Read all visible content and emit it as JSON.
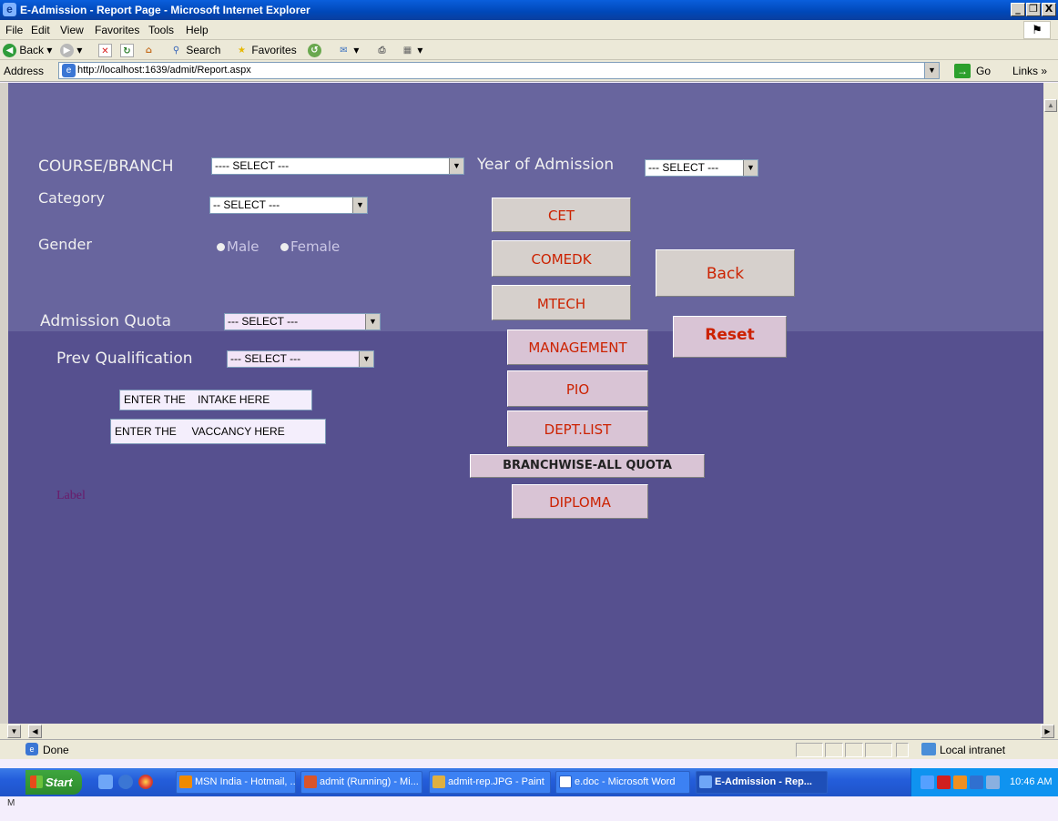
{
  "window": {
    "title": "E-Admission - Report Page - Microsoft Internet Explorer",
    "buttons": [
      "_",
      "❐",
      "X"
    ]
  },
  "menu": [
    "File",
    "Edit",
    "View",
    "Favorites",
    "Tools",
    "Help"
  ],
  "toolbar": {
    "back": "Back",
    "search": "Search",
    "favorites": "Favorites"
  },
  "address": {
    "label": "Address",
    "url": "http://localhost:1639/admit/Report.aspx",
    "go": "Go",
    "links": "Links »"
  },
  "form": {
    "course_label": "COURSE/BRANCH",
    "course_value": "---- SELECT ---",
    "year_label": "Year of Admission",
    "year_value": "--- SELECT ---",
    "category_label": "Category",
    "category_value": "-- SELECT ---",
    "gender_label": "Gender",
    "gender_male": "Male",
    "gender_female": "Female",
    "quota_label": "Admission Quota",
    "quota_value": "--- SELECT ---",
    "prev_label": "Prev Qualification",
    "prev_value": "--- SELECT ---",
    "intake_text": "ENTER THE    INTAKE HERE",
    "vacancy_text": "ENTER THE     VACCANCY HERE",
    "label_text": "Label"
  },
  "buttons": {
    "cet": "CET",
    "comedk": "COMEDK",
    "mtech": "MTECH",
    "management": "MANAGEMENT",
    "pio": "PIO",
    "dept_list": "DEPT.LIST",
    "branchwise": "BRANCHWISE-ALL QUOTA",
    "diploma": "DIPLOMA",
    "back": "Back",
    "reset": "Reset"
  },
  "status": {
    "text": "Done",
    "zone": "Local intranet"
  },
  "taskbar": {
    "start": "Start",
    "tasks": [
      "MSN India - Hotmail, ...",
      "admit (Running) - Mi...",
      "admit-rep.JPG - Paint",
      "e.doc - Microsoft Word",
      "E-Admission - Rep..."
    ],
    "clock": "10:46 AM"
  },
  "colors": {
    "page_bg": "#56508f",
    "page_upper_bg": "#68659e",
    "button_text": "#cc2200",
    "label_text": "#f0f0f0"
  }
}
